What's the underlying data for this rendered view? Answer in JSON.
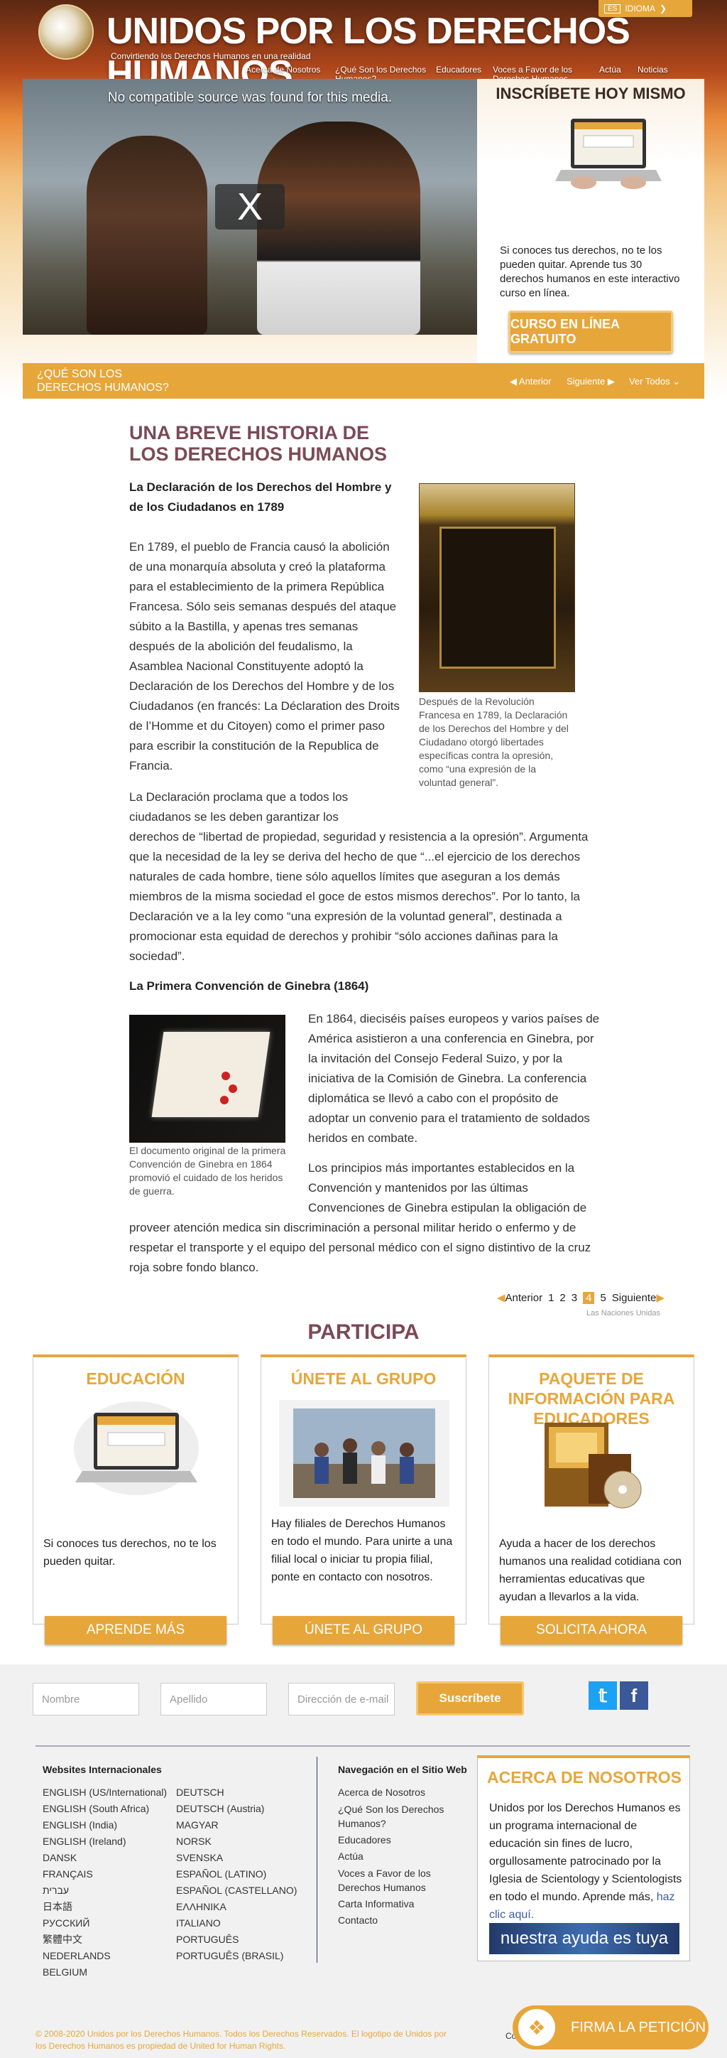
{
  "header": {
    "site_title": "UNIDOS POR LOS DERECHOS HUMANOS",
    "tagline": "Convirtiendo los Derechos Humanos en una realidad",
    "language": {
      "code": "ES",
      "label": "IDIOMA"
    },
    "nav": [
      {
        "label": "Acerca de Nosotros"
      },
      {
        "label": "¿Qué Son los Derechos Humanos?"
      },
      {
        "label": "Educadores"
      },
      {
        "label": "Voces a Favor de los Derechos Humanos"
      },
      {
        "label": "Actúa"
      },
      {
        "label": "Noticias"
      }
    ]
  },
  "video": {
    "message": "No compatible source was found for this media.",
    "close_label": "X"
  },
  "signup": {
    "title": "INSCRÍBETE HOY MISMO",
    "text": "Si conoces tus derechos, no te los pueden quitar. Aprende tus 30 derechos humanos en este interactivo curso en línea.",
    "button": "CURSO EN LÍNEA GRATUITO"
  },
  "section_bar": {
    "label": "¿QUÉ SON LOS DERECHOS HUMANOS?",
    "prev": "Anterior",
    "next": "Siguiente",
    "view_all": "Ver Todos"
  },
  "article": {
    "title": "UNA BREVE HISTORIA DE LOS DERECHOS HUMANOS",
    "subtitle1": "La Declaración de los Derechos del Hombre y de los Ciudadanos en 1789",
    "para1": "En 1789, el pueblo de Francia causó la abolición de una monarquía absoluta y creó la plataforma para el establecimiento de la primera República Francesa. Sólo seis semanas después del ataque súbito a la Bastilla, y apenas tres semanas después de la abolición del feudalismo, la Asamblea Nacional Constituyente adoptó la Declaración de los Derechos del Hombre y de los Ciudadanos (en francés: La Déclaration des Droits de l’Homme et du Citoyen) como el primer paso para escribir la constitución de la Republica de Francia.",
    "para2_a": "La Declaración proclama que a todos los ciudadanos se les deben garantizar los",
    "para2_b": "derechos de “libertad de propiedad, seguridad y resistencia a la opresión”. Argumenta que la necesidad de la ley se deriva del hecho de que “...el ejercicio de los derechos naturales de cada hombre, tiene sólo aquellos límites que aseguran a los demás miembros de la misma sociedad el goce de estos mismos derechos”. Por lo tanto, la Declaración ve a la ley como “una expresión de la voluntad general”, destinada a promocionar esta equidad de derechos y prohibir “sólo acciones dañinas para la sociedad”.",
    "caption1": "Después de la Revolución Francesa en 1789, la Declaración de los Derechos del Hombre y del Ciudadano otorgó libertades específicas contra la opresión, como “una expresión de la voluntad general”.",
    "subtitle2": "La Primera Convención de Ginebra (1864)",
    "para3": "En 1864, dieciséis países europeos y varios países de América asistieron a una conferencia en Ginebra, por la invitación del Consejo Federal Suizo, y por la iniciativa de la Comisión de Ginebra. La conferencia diplomática se llevó a cabo con el propósito de adoptar un convenio para el tratamiento de soldados heridos en combate.",
    "para4_a": "Los principios más importantes establecidos en la Convención y mantenidos por las últimas Convenciones de Ginebra estipulan la obligación de",
    "para4_b": "proveer atención medica sin discriminación a personal militar herido o enfermo y de respetar el transporte y el equipo del personal médico con el signo distintivo de la cruz roja sobre fondo blanco.",
    "caption2": "El documento original de la primera Convención de Ginebra en 1864 promovió el cuidado de los heridos de guerra."
  },
  "pagination": {
    "prev": "Anterior",
    "pages": [
      "1",
      "2",
      "3",
      "4",
      "5"
    ],
    "current": "4",
    "next": "Siguiente",
    "credit": "Las Naciones Unidas"
  },
  "participa": {
    "title": "PARTICIPA",
    "cards": [
      {
        "title": "EDUCACIÓN",
        "text": "Si conoces tus derechos, no te los pueden quitar.",
        "button": "APRENDE MÁS"
      },
      {
        "title": "ÚNETE AL GRUPO",
        "text": "Hay filiales de Derechos Humanos en todo el mundo. Para unirte a una filial local o iniciar tu propia filial, ponte en contacto con nosotros.",
        "button": "ÚNETE AL GRUPO"
      },
      {
        "title": "PAQUETE DE INFORMACIÓN PARA EDUCADORES",
        "text": "Ayuda a hacer de los derechos humanos una realidad cotidiana con herramientas educativas que ayudan a llevarlos a la vida.",
        "button": "SOLICITA AHORA"
      }
    ]
  },
  "newsletter": {
    "first_name_placeholder": "Nombre",
    "last_name_placeholder": "Apellido",
    "email_placeholder": "Dirección de e-mail",
    "submit": "Suscríbete"
  },
  "footer": {
    "intl_heading": "Websites Internacionales",
    "intl_col1": [
      "ENGLISH (US/International)",
      "ENGLISH (South Africa)",
      "ENGLISH (India)",
      "ENGLISH (Ireland)",
      "DANSK",
      "FRANÇAIS",
      "עברית",
      "日本語",
      "РУССКИЙ",
      "繁體中文",
      "NEDERLANDS",
      "BELGIUM"
    ],
    "intl_col2": [
      "DEUTSCH",
      "DEUTSCH (Austria)",
      "MAGYAR",
      "NORSK",
      "SVENSKA",
      "ESPAÑOL (LATINO)",
      "ESPAÑOL (CASTELLANO)",
      "ΕΛΛΗΝΙΚΑ",
      "ITALIANO",
      "PORTUGUÊS",
      "PORTUGUÊS (BRASIL)"
    ],
    "nav_heading": "Navegación en el Sitio Web",
    "nav_links": [
      "Acerca de Nosotros",
      "¿Qué Son los Derechos Humanos?",
      "Educadores",
      "Actúa",
      "Voces a Favor de los Derechos Humanos",
      "Carta Informativa",
      "Contacto"
    ],
    "about_title": "ACERCA DE NOSOTROS",
    "about_text": "Unidos por los Derechos Humanos es un programa internacional de educación sin fines de lucro, orgullosamente patrocinado por la Iglesia de Scientology y Scientologists en todo el mundo. Aprende más,",
    "about_link": "haz clic aquí.",
    "help_banner": "nuestra ayuda es tuya",
    "copyright": "© 2008-2020 Unidos por los Derechos Humanos. Todos los Derechos Reservados. El logotipo de Unidos por los Derechos Humanos es propiedad de United for Human Rights.",
    "co_text": "Co",
    "sign_button": "FIRMA LA PETICIÓN"
  },
  "colors": {
    "accent": "#e7a63a",
    "title": "#7b4a56",
    "footer_blue": "#2c3f6a"
  },
  "icons": [
    "globe-logo",
    "triangle-left-icon",
    "triangle-right-icon",
    "chevron-down-icon",
    "twitter-icon",
    "facebook-icon",
    "dove-icon"
  ]
}
